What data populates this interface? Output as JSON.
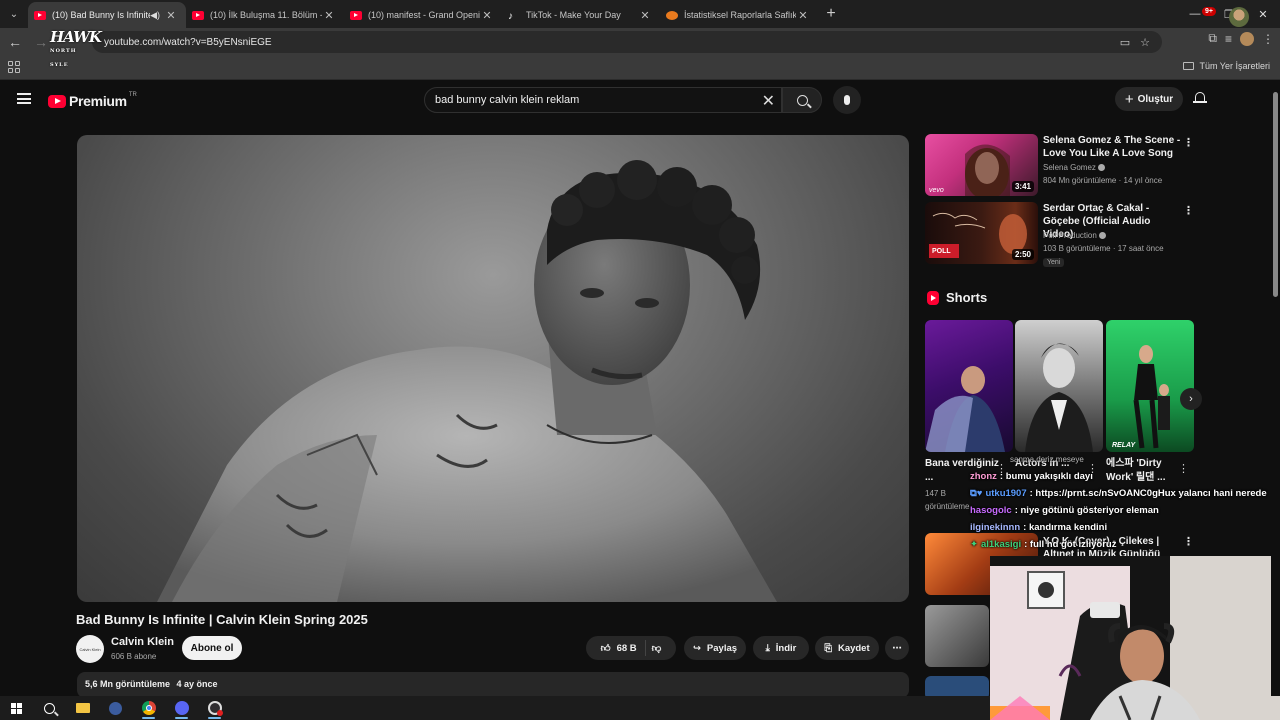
{
  "browser": {
    "tabs": [
      {
        "title": "(10) Bad Bunny Is Infinite | C",
        "active": true,
        "favicon": "youtube-icon",
        "audio": true
      },
      {
        "title": "(10) İlk Buluşma 11. Bölüm - Yo",
        "favicon": "youtube-icon"
      },
      {
        "title": "(10) manifest - Grand Opening",
        "favicon": "youtube-icon"
      },
      {
        "title": "TikTok - Make Your Day",
        "favicon": "tiktok-icon"
      },
      {
        "title": "İstatistiksel Raporlarla Saflık Tes",
        "favicon": "stats-icon"
      }
    ],
    "url": "youtube.com/watch?v=B5yENsniEGE",
    "bookmarks_label": "Tüm Yer İşaretleri"
  },
  "overlay_logo": {
    "text": "HAWK",
    "sub": "NORTH SYLE"
  },
  "yt": {
    "logo_word": "Premium",
    "logo_region": "TR",
    "search_value": "bad bunny calvin klein reklam",
    "create_label": "Oluştur",
    "notif_badge": "9+"
  },
  "video": {
    "title": "Bad Bunny Is Infinite | Calvin Klein Spring 2025",
    "channel": "Calvin Klein",
    "channel_avatar_text": "Calvin Klein",
    "subscribers": "606 B abone",
    "subscribe_label": "Abone ol",
    "likes": "68 B",
    "share_label": "Paylaş",
    "download_label": "İndir",
    "save_label": "Kaydet",
    "views": "5,6 Mn görüntüleme",
    "age": "4 ay önce"
  },
  "recommendations": [
    {
      "title": "Selena Gomez & The Scene - Love You Like A Love Song",
      "channel": "Selena Gomez",
      "meta": "804 Mn görüntüleme · 14 yıl önce",
      "duration": "3:41",
      "thumb_label": "vevo"
    },
    {
      "title": "Serdar Ortaç & Cakal - Göçebe (Official Audio Video)",
      "channel": "Poll Production",
      "meta": "103 B görüntüleme · 17 saat önce",
      "duration": "2:50",
      "badge": "Yeni",
      "thumb_label": "POLL"
    },
    {
      "title": "Y.O.K. (Cover) - Çilekes | Altınet in Müzik Günlüğü",
      "channel": "",
      "meta": ""
    }
  ],
  "shorts": {
    "heading": "Shorts",
    "items": [
      {
        "title": "Bana verdiğiniz ...",
        "views": "147 B",
        "views_unit": "görüntüleme"
      },
      {
        "title": "Actors in ...",
        "views": ""
      },
      {
        "title": "에스파 'Dirty Work' 릴댄 ...",
        "views": "",
        "thumb_label": "RELAY"
      }
    ]
  },
  "chat": [
    {
      "user": "zhonz",
      "text": ": bumu yakışıklı dayı",
      "color": "#ff9dd5"
    },
    {
      "user": "utku1907",
      "text": ": https://prnt.sc/nSvOANC0gHux yalancı hani nerede",
      "color": "#5b9dff"
    },
    {
      "user": "hasogolc",
      "text": ": niye götünü gösteriyor eleman",
      "color": "#c86bff"
    },
    {
      "user": "ilginekinnn",
      "text": ": kandırma kendini",
      "color": "#a7b8ff"
    },
    {
      "user": "al1kasigi",
      "text": ": full hd göt izliyoruz",
      "color": "#3fd17a"
    }
  ],
  "chat_bg_text": "sanma deriz meseye"
}
